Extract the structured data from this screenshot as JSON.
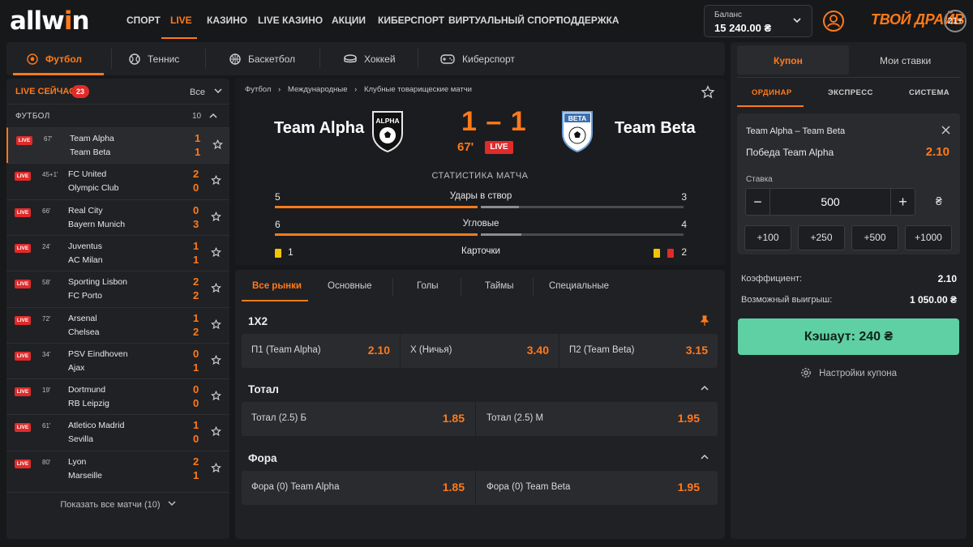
{
  "brand": {
    "logo_prefix": "allw",
    "logo_accent": "i",
    "logo_suffix": "n",
    "slogan": "ТВОЙ ДРАЙВ",
    "age": "21+",
    "accent_color": "#ff7a1a"
  },
  "nav": {
    "items": [
      "СПОРТ",
      "LIVE",
      "КАЗИНО",
      "LIVE КАЗИНО",
      "АКЦИИ",
      "КИБЕРСПОРТ",
      "ВИРТУАЛЬНЫЙ СПОРТ",
      "ПОДДЕРЖКА"
    ],
    "active": "LIVE"
  },
  "balance": {
    "label": "Баланс",
    "value": "15 240.00 ₴"
  },
  "sport_tabs": [
    {
      "label": "Футбол",
      "icon": "soccer-ball-icon"
    },
    {
      "label": "Теннис",
      "icon": "tennis-ball-icon"
    },
    {
      "label": "Баскетбол",
      "icon": "basketball-icon"
    },
    {
      "label": "Хоккей",
      "icon": "hockey-puck-icon"
    },
    {
      "label": "Киберспорт",
      "icon": "gamepad-icon"
    }
  ],
  "live_panel": {
    "title": "LIVE СЕЙЧАС",
    "count": "23",
    "filter": "Все",
    "section": {
      "title": "ФУТБОЛ",
      "count": "10"
    },
    "live_tag": "LIVE",
    "matches": [
      {
        "time": "67'",
        "team1": "Team Alpha",
        "team2": "Team Beta",
        "score1": "1",
        "score2": "1"
      },
      {
        "time": "45+1'",
        "team1": "FC United",
        "team2": "Olympic Club",
        "score1": "2",
        "score2": "0"
      },
      {
        "time": "66'",
        "team1": "Real City",
        "team2": "Bayern Munich",
        "score1": "0",
        "score2": "3"
      },
      {
        "time": "24'",
        "team1": "Juventus",
        "team2": "AC Milan",
        "score1": "1",
        "score2": "1"
      },
      {
        "time": "58'",
        "team1": "Sporting Lisbon",
        "team2": "FC Porto",
        "score1": "2",
        "score2": "2"
      },
      {
        "time": "72'",
        "team1": "Arsenal",
        "team2": "Chelsea",
        "score1": "1",
        "score2": "2"
      },
      {
        "time": "34'",
        "team1": "PSV Eindhoven",
        "team2": "Ajax",
        "score1": "0",
        "score2": "1"
      },
      {
        "time": "19'",
        "team1": "Dortmund",
        "team2": "RB Leipzig",
        "score1": "0",
        "score2": "0"
      },
      {
        "time": "61'",
        "team1": "Atletico Madrid",
        "team2": "Sevilla",
        "score1": "1",
        "score2": "0"
      },
      {
        "time": "80'",
        "team1": "Lyon",
        "team2": "Marseille",
        "score1": "2",
        "score2": "1"
      }
    ],
    "show_all": "Показать все матчи (10)"
  },
  "event": {
    "breadcrumb": [
      "Футбол",
      "Международные",
      "Клубные товарищеские матчи"
    ],
    "home": "Team Alpha",
    "away": "Team Beta",
    "home_crest_text": "ALPHA",
    "away_crest_text": "BETA",
    "score": "1 – 1",
    "minute": "67'",
    "live": "LIVE",
    "stats_title": "СТАТИСТИКА МАТЧА",
    "stats": [
      {
        "name": "Удары в створ",
        "home": "5",
        "away": "3",
        "home_value": 5,
        "away_value": 3
      },
      {
        "name": "Угловые",
        "home": "6",
        "away": "4",
        "home_value": 6,
        "away_value": 4
      },
      {
        "name": "Карточки",
        "home": "1",
        "away": "2"
      }
    ]
  },
  "markets": {
    "tabs": [
      "Все рынки",
      "Основные",
      "Голы",
      "Таймы",
      "Специальные"
    ],
    "groups": [
      {
        "title": "1X2",
        "outcomes": [
          {
            "label": "П1 (Team Alpha)",
            "odd": "2.10"
          },
          {
            "label": "X (Ничья)",
            "odd": "3.40"
          },
          {
            "label": "П2 (Team Beta)",
            "odd": "3.15"
          }
        ]
      },
      {
        "title": "Тотал",
        "outcomes": [
          {
            "label": "Тотал (2.5) Б",
            "odd": "1.85"
          },
          {
            "label": "Тотал (2.5) М",
            "odd": "1.95"
          }
        ]
      },
      {
        "title": "Фора",
        "outcomes": [
          {
            "label": "Фора (0) Team Alpha",
            "odd": "1.85"
          },
          {
            "label": "Фора (0) Team Beta",
            "odd": "1.95"
          }
        ]
      }
    ]
  },
  "coupon": {
    "tabs": [
      "Купон",
      "Мои ставки"
    ],
    "bet_types": [
      "ОРДИНАР",
      "ЭКСПРЕСС",
      "СИСТЕМА"
    ],
    "event": "Team Alpha – Team Beta",
    "pick": "Победа Team Alpha",
    "odd": "2.10",
    "stake_label": "Ставка",
    "stake": "500",
    "currency": "₴",
    "quick": [
      "+100",
      "+250",
      "+500",
      "+1000"
    ],
    "coef_label": "Коэффициент:",
    "coef_value": "2.10",
    "win_label": "Возможный выигрыш:",
    "win_value": "1 050.00 ₴",
    "cashout": "Кэшаут:  240 ₴",
    "settings": "Настройки купона"
  }
}
